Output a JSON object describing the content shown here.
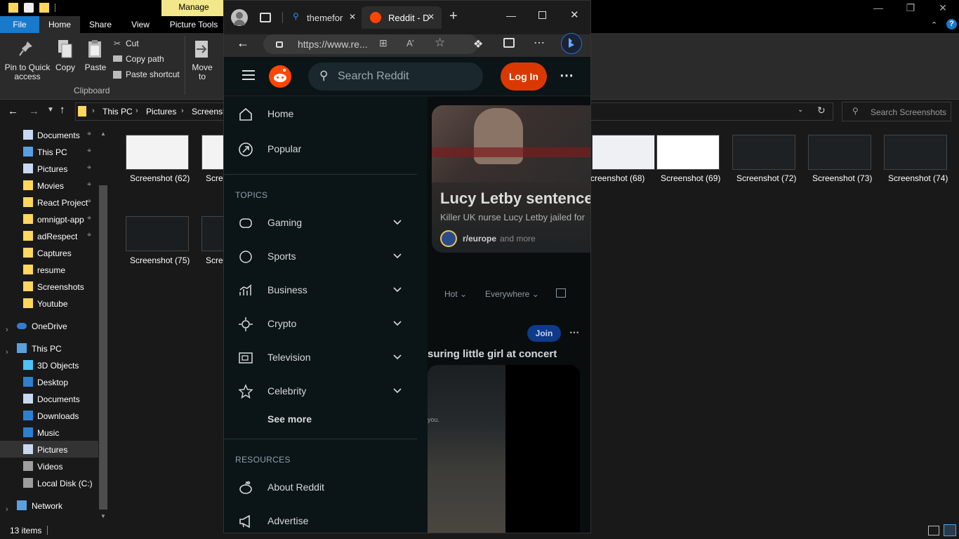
{
  "explorer": {
    "manage_tab": "Manage",
    "picture_tools": "Picture Tools",
    "tabs": [
      "File",
      "Home",
      "Share",
      "View"
    ],
    "ribbon": {
      "pin": "Pin to Quick access",
      "copy": "Copy",
      "paste": "Paste",
      "cut": "Cut",
      "copy_path": "Copy path",
      "paste_shortcut": "Paste shortcut",
      "clipboard": "Clipboard",
      "move_to": "Move to"
    },
    "breadcrumb": [
      "This PC",
      "Pictures",
      "Screensh"
    ],
    "search_placeholder": "Search Screenshots",
    "nav": [
      {
        "label": "Documents",
        "pinned": true
      },
      {
        "label": "This PC",
        "pinned": true
      },
      {
        "label": "Pictures",
        "pinned": true
      },
      {
        "label": "Movies",
        "pinned": true
      },
      {
        "label": "React Project",
        "pinned": true
      },
      {
        "label": "omnigpt-app",
        "pinned": true
      },
      {
        "label": "adRespect",
        "pinned": true
      },
      {
        "label": "Captures",
        "pinned": false
      },
      {
        "label": "resume",
        "pinned": false
      },
      {
        "label": "Screenshots",
        "pinned": false
      },
      {
        "label": "Youtube",
        "pinned": false
      }
    ],
    "onedrive": "OneDrive",
    "thispc": "This PC",
    "pc_items": [
      "3D Objects",
      "Desktop",
      "Documents",
      "Downloads",
      "Music",
      "Pictures",
      "Videos",
      "Local Disk (C:)"
    ],
    "network": "Network",
    "files": [
      "Screenshot (62)",
      "Scree",
      "creenshot (68)",
      "Screenshot (69)",
      "Screenshot (72)",
      "Screenshot (73)",
      "Screenshot (74)",
      "Screenshot (75)",
      "Scree"
    ],
    "status": "13 items"
  },
  "edge": {
    "tab1": "themefor",
    "tab2": "Reddit - D",
    "url": "https://www.re..."
  },
  "reddit": {
    "search_placeholder": "Search Reddit",
    "login": "Log In",
    "nav": [
      "Home",
      "Popular"
    ],
    "topics_header": "TOPICS",
    "topics": [
      "Gaming",
      "Sports",
      "Business",
      "Crypto",
      "Television",
      "Celebrity"
    ],
    "see_more": "See more",
    "resources_header": "RESOURCES",
    "resources": [
      "About Reddit",
      "Advertise"
    ],
    "card": {
      "title": "Lucy Letby sentence",
      "subtitle": "Killer UK nurse Lucy Letby jailed for",
      "subreddit": "r/europe",
      "suffix": "and more"
    },
    "filters": [
      "Hot",
      "Everywhere"
    ],
    "join": "Join",
    "post_title": "suring little girl at concert",
    "overlay_text": "you."
  },
  "colors": {
    "reddit_orange": "#ff4500",
    "login_bg": "#d93900",
    "explorer_accent": "#1979ca",
    "manage_yellow": "#f2e78a"
  }
}
